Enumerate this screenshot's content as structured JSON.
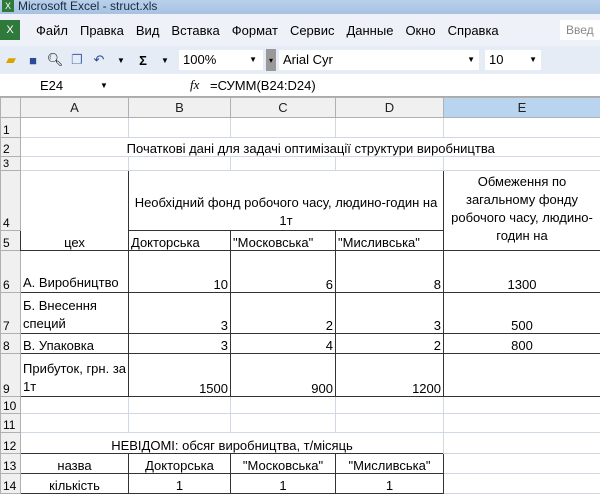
{
  "window_title": "Microsoft Excel - struct.xls",
  "menu": [
    "Файл",
    "Правка",
    "Вид",
    "Вставка",
    "Формат",
    "Сервис",
    "Данные",
    "Окно",
    "Справка"
  ],
  "help_box": "Введ",
  "toolbar": {
    "zoom": "100%",
    "font": "Arial Cyr",
    "size": "10"
  },
  "formula_bar": {
    "cell_ref": "E24",
    "fx": "fx",
    "formula": "=СУММ(B24:D24)"
  },
  "columns": [
    "A",
    "B",
    "C",
    "D",
    "E"
  ],
  "rows": [
    "1",
    "2",
    "3",
    "4",
    "5",
    "6",
    "7",
    "8",
    "9",
    "10",
    "11",
    "12",
    "13",
    "14"
  ],
  "cells": {
    "title": "Початкові дані для задачі оптимізації  структури виробництва",
    "b4": "Необхідний фонд робочого часу, людино-годин на 1т",
    "e4": "Обмеження по загальному фонду робочого часу, людино-годин на",
    "a5": "цех",
    "b5": "Докторська",
    "c5": "\"Московська\"",
    "d5": "\"Мисливська\"",
    "a6": "А. Виробництво",
    "b6": "10",
    "c6": "6",
    "d6": "8",
    "e6": "1300",
    "a7": "Б. Внесення специй",
    "b7": "3",
    "c7": "2",
    "d7": "3",
    "e7": "500",
    "a8": "В. Упаковка",
    "b8": "3",
    "c8": "4",
    "d8": "2",
    "e8": "800",
    "a9": "Прибуток, грн. за 1т",
    "b9": "1500",
    "c9": "900",
    "d9": "1200",
    "a12": "НЕВІДОМІ: обсяг виробництва, т/місяць",
    "a13": "назва",
    "b13": "Докторська",
    "c13": "\"Московська\"",
    "d13": "\"Мисливська\"",
    "a14": "кількість",
    "b14": "1",
    "c14": "1",
    "d14": "1"
  }
}
